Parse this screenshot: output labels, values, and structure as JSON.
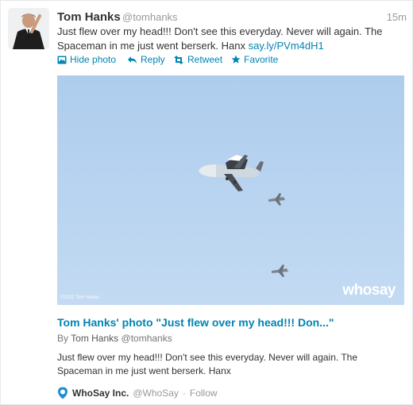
{
  "tweet": {
    "user_name": "Tom Hanks",
    "screen_name": "@tomhanks",
    "timestamp": "15m",
    "text": "Just flew over my head!!! Don't see this everyday. Never will again. The Spaceman in me just went berserk. Hanx",
    "link": "say.ly/PVm4dH1"
  },
  "actions": {
    "hide_photo": "Hide photo",
    "reply": "Reply",
    "retweet": "Retweet",
    "favorite": "Favorite"
  },
  "photo": {
    "credit": "©2012 Tom Hanks",
    "watermark": "whosay"
  },
  "card": {
    "title": "Tom Hanks' photo \"Just flew over my head!!! Don...\"",
    "byline_prefix": "By",
    "byline_author": "Tom Hanks",
    "byline_handle": "@tomhanks",
    "description": "Just flew over my head!!! Don't see this everyday. Never will again. The Spaceman in me just went berserk. Hanx"
  },
  "attribution": {
    "name": "WhoSay Inc.",
    "handle": "@WhoSay",
    "separator": "·",
    "follow": "Follow"
  },
  "colors": {
    "link": "#0084b4",
    "muted": "#999999",
    "sky": "#b7d3f0"
  },
  "icons": [
    "photo-icon",
    "reply-icon",
    "retweet-icon",
    "favorite-star-icon",
    "whosay-pin-icon"
  ]
}
